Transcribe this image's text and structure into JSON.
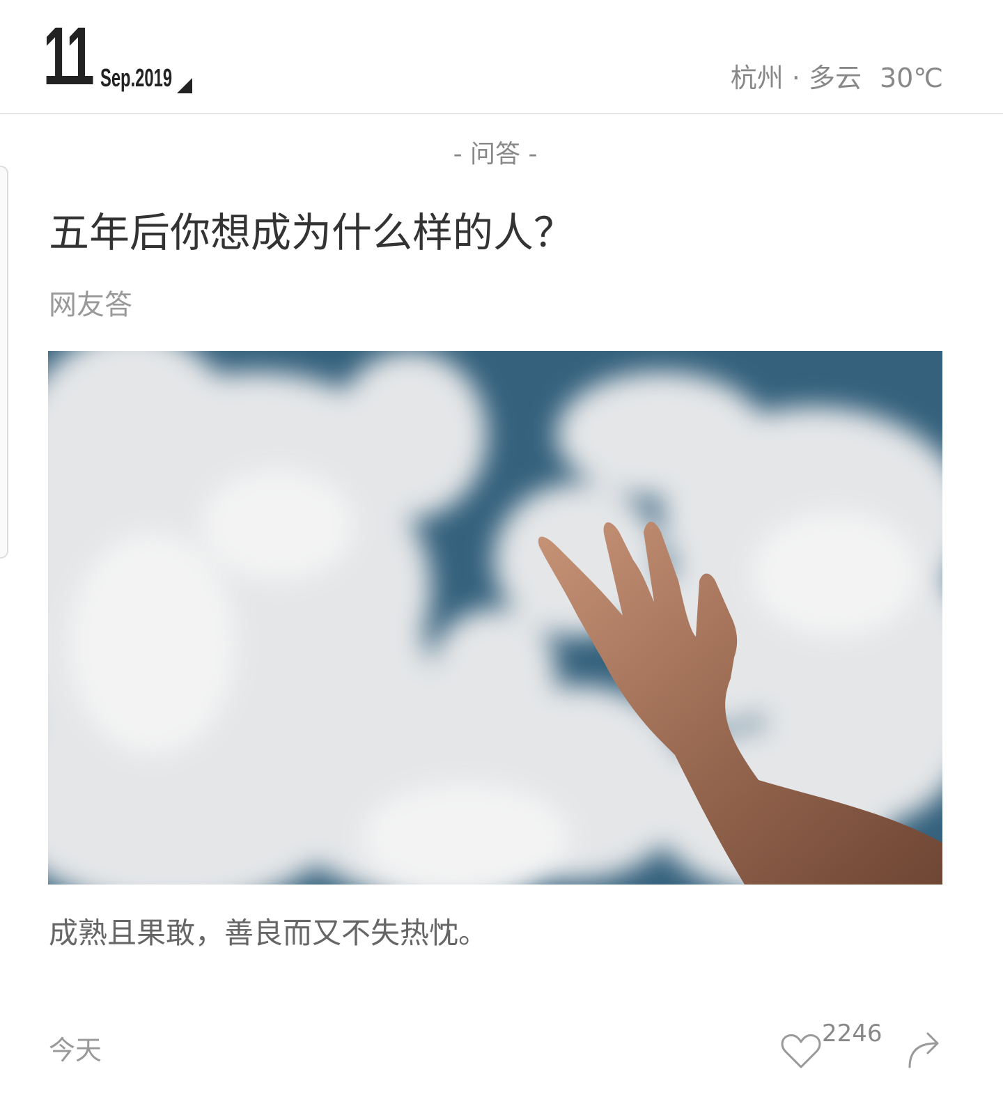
{
  "header": {
    "day": "11",
    "month_year": "Sep.2019",
    "weather": {
      "city": "杭州",
      "separator": " · ",
      "condition": "多云",
      "temperature": "30℃"
    }
  },
  "card": {
    "category": "- 问答 -",
    "title": "五年后你想成为什么样的人？",
    "author": "网友答",
    "quote": "成熟且果敢，善良而又不失热忱。",
    "date_label": "今天",
    "like_count": "2246",
    "icons": {
      "like": "heart-outline-icon",
      "share": "share-arrow-icon",
      "date_picker": "triangle-caret-icon"
    }
  },
  "colors": {
    "text_primary": "#333333",
    "text_secondary": "#999999",
    "sky": "#2f5c78",
    "divider": "#e6e6e6"
  }
}
